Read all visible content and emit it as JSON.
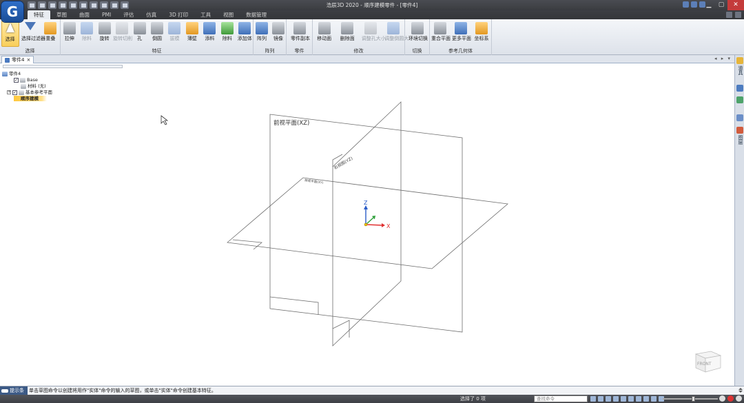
{
  "window": {
    "title": "浩辰3D 2020 - 顺序建模零件 - [零件4]",
    "controls": {
      "minimize": "▁",
      "maximize": "▢",
      "close": "✕"
    }
  },
  "app_logo": "G",
  "ribbon_tabs": [
    "特征",
    "草图",
    "曲面",
    "PMI",
    "评估",
    "仿真",
    "3D 打印",
    "工具",
    "视图",
    "数据管理"
  ],
  "active_tab": "特征",
  "ribbon": {
    "groups": [
      {
        "id": "select",
        "label": "选择",
        "buttons": [
          {
            "label": "选择",
            "icon": "cursor-icon",
            "active": true
          },
          {
            "label": "选择过滤器",
            "icon": "filter-icon"
          },
          {
            "label": "重叠",
            "icon": "overlap-icon"
          }
        ]
      },
      {
        "id": "features",
        "label": "特征",
        "buttons": [
          {
            "label": "拉伸",
            "icon": "extrude-icon"
          },
          {
            "label": "除料",
            "icon": "cut-icon",
            "dim": true
          },
          {
            "label": "旋转",
            "icon": "revolve-icon"
          },
          {
            "label": "旋转切削",
            "icon": "revolve-cut-icon",
            "dim": true
          },
          {
            "label": "孔",
            "icon": "hole-icon"
          },
          {
            "label": "倒圆",
            "icon": "round-icon"
          },
          {
            "label": "拔模",
            "icon": "draft-icon",
            "dim": true
          },
          {
            "label": "薄壁",
            "icon": "thin-wall-icon"
          },
          {
            "label": "添料",
            "icon": "add-material-icon"
          },
          {
            "label": "除料",
            "icon": "remove-material-icon"
          },
          {
            "label": "添加体",
            "icon": "add-body-icon"
          }
        ]
      },
      {
        "id": "pattern",
        "label": "阵列",
        "buttons": [
          {
            "label": "阵列",
            "icon": "pattern-icon"
          },
          {
            "label": "镜像",
            "icon": "mirror-icon"
          }
        ]
      },
      {
        "id": "copy",
        "label": "零件",
        "buttons": [
          {
            "label": "零件副本",
            "icon": "part-copy-icon"
          }
        ]
      },
      {
        "id": "modify",
        "label": "修改",
        "buttons": [
          {
            "label": "移动面",
            "icon": "move-face-icon"
          },
          {
            "label": "删除面",
            "icon": "delete-face-icon"
          },
          {
            "label": "调整孔大小",
            "icon": "resize-hole-icon",
            "dim": true
          },
          {
            "label": "调整倒圆大小",
            "icon": "resize-round-icon",
            "dim": true
          }
        ]
      },
      {
        "id": "switch",
        "label": "切换",
        "buttons": [
          {
            "label": "环境切换",
            "icon": "env-switch-icon"
          }
        ]
      },
      {
        "id": "refgeom",
        "label": "参考几何体",
        "buttons": [
          {
            "label": "重合平面",
            "icon": "coincident-plane-icon"
          },
          {
            "label": "更多平面",
            "icon": "more-planes-icon"
          },
          {
            "label": "坐标系",
            "icon": "coord-system-icon"
          }
        ]
      }
    ]
  },
  "document_tab": {
    "label": "零件4",
    "close": "×"
  },
  "doc_nav": "◂ ▸ ▾",
  "pathfinder": {
    "root": "零件4",
    "items": [
      {
        "label": "Base",
        "checked": true
      },
      {
        "label": "材料 (无)"
      },
      {
        "label": "基本参考平面",
        "checked": true,
        "expander": "+"
      }
    ],
    "sequential": "顺序建模"
  },
  "viewport": {
    "planes": {
      "front": "前视平面(XZ)",
      "right": "右视图(YZ)",
      "top": "俯视平面(XY)"
    },
    "axes": {
      "x": "X",
      "y": "Y",
      "z": "Z"
    },
    "view_cube": "FRONT"
  },
  "right_panel": [
    "道具",
    "图层"
  ],
  "prompt": {
    "label": "提示条",
    "text": "单击草图命令以创建将用作\"实体\"命令的输入的草图，或单击\"实体\"命令创建基本特征。"
  },
  "status": {
    "selection": "选择了 0 项",
    "command_search": "查找命令"
  },
  "colors": {
    "title_bar": "#3a3c40",
    "ribbon": "#e9ecf1",
    "accent": "#2f6fc9",
    "active_button": "#f9cf5a",
    "highlight": "#ffc83d",
    "axis_x": "#e03030",
    "axis_y": "#2fa03a",
    "axis_z": "#2a5cc8"
  }
}
